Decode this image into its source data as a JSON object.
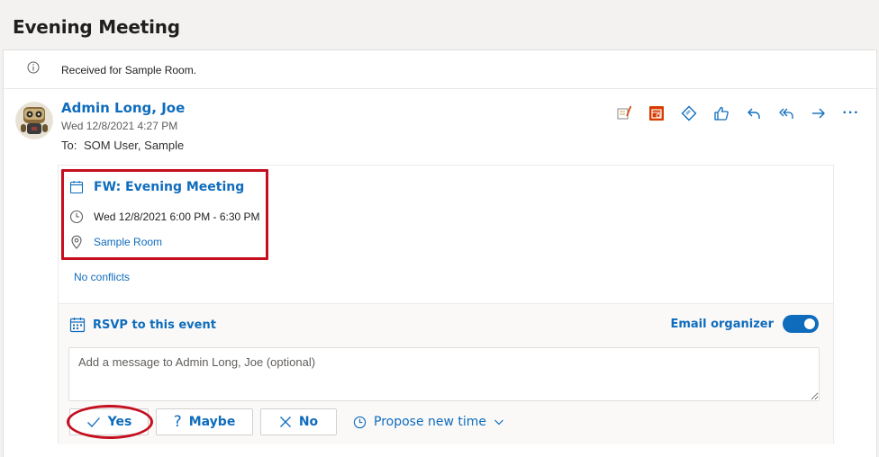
{
  "page": {
    "title": "Evening Meeting"
  },
  "info": {
    "text": "Received for Sample Room."
  },
  "message": {
    "sender": "Admin Long, Joe",
    "date": "Wed 12/8/2021 4:27 PM",
    "to_label": "To:",
    "to_value": "SOM User, Sample"
  },
  "toolbar": {
    "icons": [
      "forward-note-icon",
      "teams-calendar-icon",
      "diamond-tag-icon",
      "like-icon",
      "reply-icon",
      "reply-all-icon",
      "forward-icon",
      "more-icon"
    ],
    "more_label": "···"
  },
  "event": {
    "title": "FW: Evening Meeting",
    "time": "Wed 12/8/2021 6:00 PM - 6:30 PM",
    "location": "Sample Room",
    "conflicts": "No conflicts"
  },
  "rsvp": {
    "label": "RSVP to this event",
    "email_organizer_label": "Email organizer",
    "email_organizer_on": true,
    "message_placeholder": "Add a message to Admin Long, Joe (optional)",
    "yes_label": "Yes",
    "maybe_label": "Maybe",
    "no_label": "No",
    "propose_label": "Propose new time"
  },
  "colors": {
    "accent": "#0f6cbd",
    "highlight": "#c50f1f",
    "background": "#f3f2f1"
  }
}
